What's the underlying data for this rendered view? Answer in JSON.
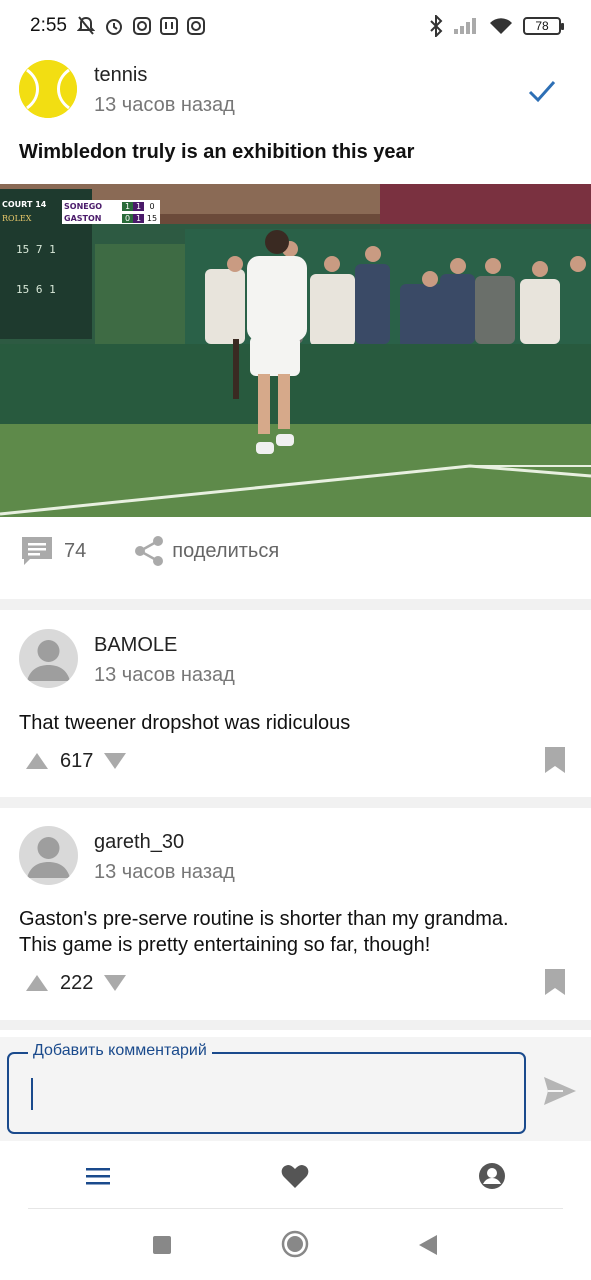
{
  "status_bar": {
    "time": "2:55",
    "battery": "78"
  },
  "post": {
    "community": "tennis",
    "time_ago": "13 часов назад",
    "title": "Wimbledon truly is an exhibition this year",
    "scoreboard": {
      "court": "COURT 14",
      "brand": "ROLEX",
      "player1": "SONEGO",
      "player1_sets": "1",
      "player1_games": "1",
      "player1_points": "0",
      "player2": "GASTON",
      "player2_sets": "0",
      "player2_games": "1",
      "player2_points": "15",
      "board_row1_a": "15",
      "board_row1_b": "7",
      "board_row1_c": "1",
      "board_row2_a": "15",
      "board_row2_b": "6",
      "board_row2_c": "1"
    },
    "comments_count": "74",
    "share_label": "поделиться"
  },
  "comments": [
    {
      "user": "BAMOLE",
      "time_ago": "13 часов назад",
      "text": "That tweener dropshot was ridiculous",
      "score": "617"
    },
    {
      "user": "gareth_30",
      "time_ago": "13 часов назад",
      "text_line1": "Gaston's pre-serve routine is shorter than my grandma.",
      "text_line2": "This game is pretty entertaining so far, though!",
      "score": "222"
    }
  ],
  "comment_input": {
    "label": "Добавить комментарий",
    "value": ""
  },
  "colors": {
    "accent": "#1a4a8c",
    "check": "#2d6fb5",
    "icon_gray": "#aaaaaa"
  },
  "icons": {
    "menu": "menu-icon",
    "favorites": "heart-icon",
    "profile": "account-circle-icon"
  }
}
